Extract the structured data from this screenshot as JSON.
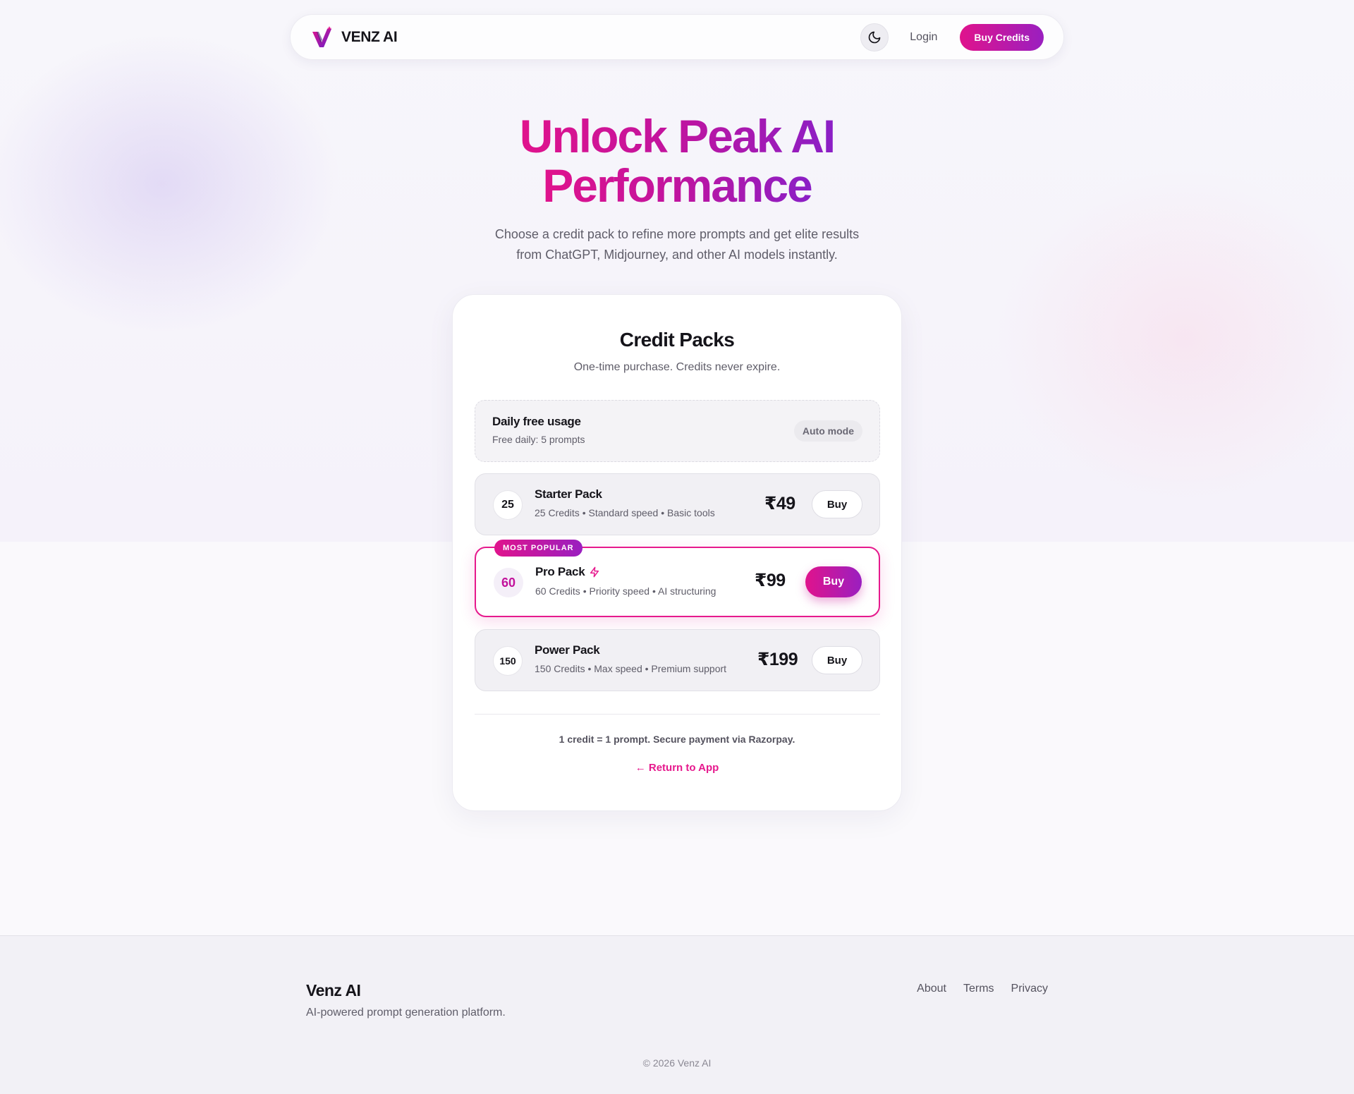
{
  "nav": {
    "brand": "VENZ AI",
    "login": "Login",
    "buy_credits": "Buy Credits"
  },
  "hero": {
    "title_line1": "Unlock Peak AI",
    "title_line2": "Performance",
    "subtitle_line1": "Choose a credit pack to refine more prompts and get elite results",
    "subtitle_line2": "from ChatGPT, Midjourney, and other AI models instantly."
  },
  "card": {
    "title": "Credit Packs",
    "subtitle": "One-time purchase. Credits never expire.",
    "free": {
      "title": "Daily free usage",
      "subtitle": "Free daily: 5 prompts",
      "badge": "Auto mode"
    },
    "packs": [
      {
        "credits": "25",
        "name": "Starter Pack",
        "desc": "25 Credits • Standard speed • Basic tools",
        "price": "₹49",
        "buy": "Buy"
      },
      {
        "credits": "60",
        "name": "Pro Pack",
        "desc": "60 Credits • Priority speed • AI structuring",
        "price": "₹99",
        "buy": "Buy",
        "badge": "MOST POPULAR"
      },
      {
        "credits": "150",
        "name": "Power Pack",
        "desc": "150 Credits • Max speed • Premium support",
        "price": "₹199",
        "buy": "Buy"
      }
    ],
    "note": "1 credit = 1 prompt. Secure payment via Razorpay.",
    "return_link": "← Return to App"
  },
  "footer": {
    "brand": "Venz AI",
    "tagline": "AI-powered prompt generation platform.",
    "links": [
      "About",
      "Terms",
      "Privacy"
    ],
    "copyright": "© 2026 Venz AI"
  },
  "colors": {
    "accent_pink": "#e0138c",
    "accent_purple": "#9a1fc0",
    "text_dark": "#15141a"
  }
}
